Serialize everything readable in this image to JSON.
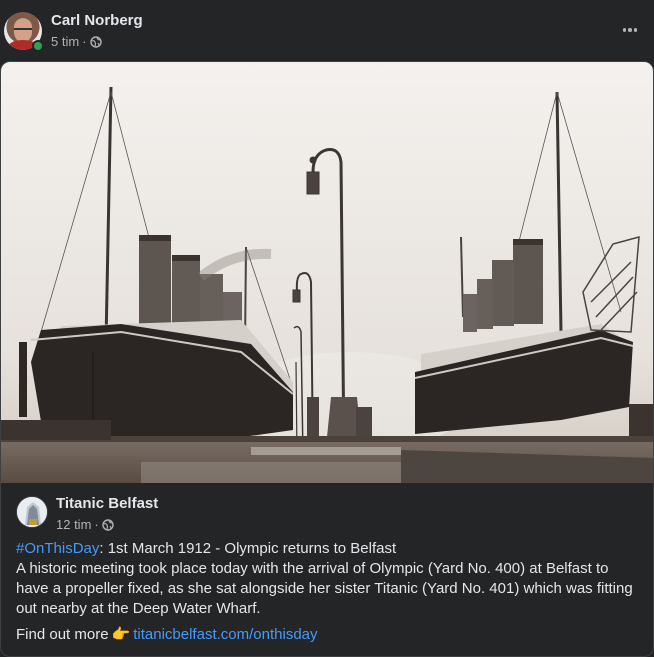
{
  "post": {
    "author": "Carl Norberg",
    "time": "5 tim",
    "separator": "·",
    "audience_icon": "globe-icon",
    "more_icon": "more-options-icon"
  },
  "shared": {
    "page_name": "Titanic Belfast",
    "time": "12 tim",
    "separator": "·",
    "audience_icon": "globe-icon",
    "hashtag": "#OnThisDay",
    "headline_rest": ": 1st March 1912 - Olympic returns to Belfast",
    "body": "A historic meeting took place today with the arrival of Olympic (Yard No. 400) at Belfast to have a propeller fixed, as she sat alongside her sister Titanic (Yard No. 401) which was fitting out nearby at the Deep Water Wharf.",
    "find_more": "Find out more",
    "pointing_emoji": "👉",
    "link": "titanicbelfast.com/onthisday"
  },
  "colors": {
    "background": "#242526",
    "primary_text": "#e4e6eb",
    "secondary_text": "#b0b3b8",
    "link": "#4599ff",
    "online": "#31a24c"
  }
}
